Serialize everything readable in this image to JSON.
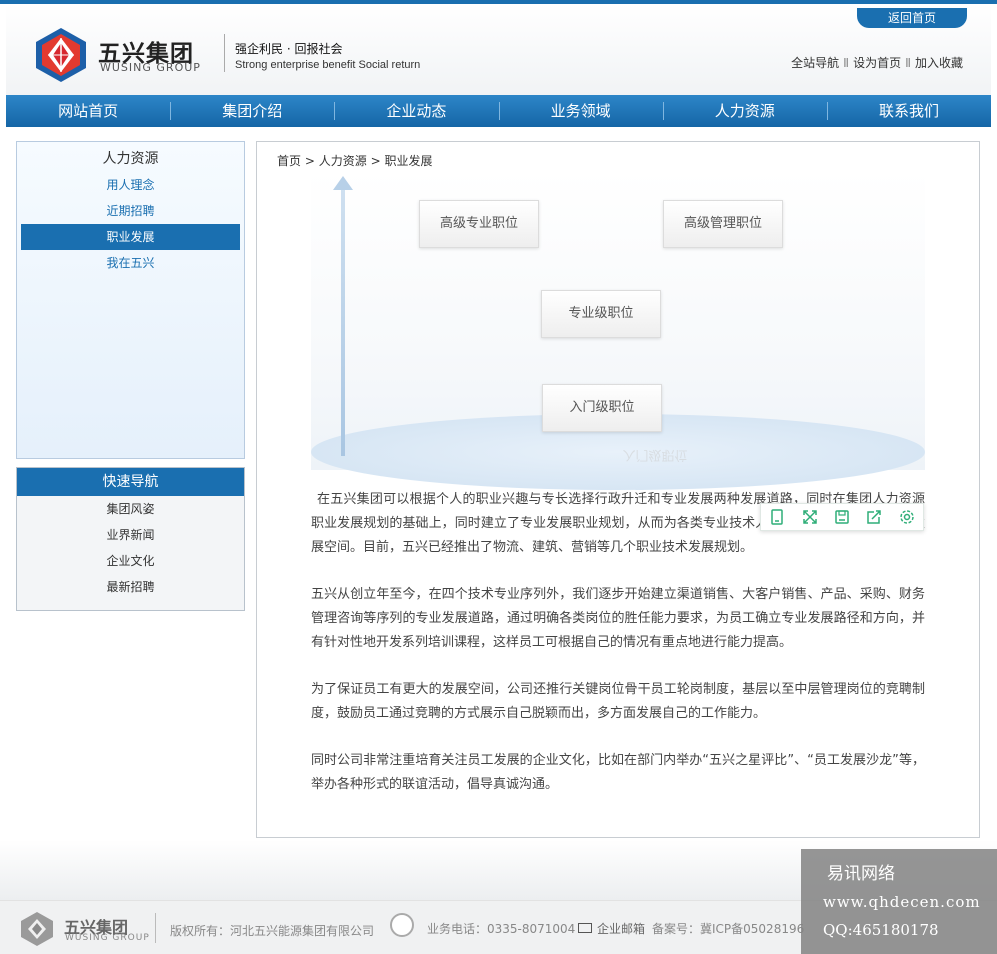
{
  "header": {
    "back_home": "返回首页",
    "logo_cn": "五兴集团",
    "logo_en": "WUSING GROUP",
    "slogan_cn": "强企利民 · 回报社会",
    "slogan_en": "Strong enterprise benefit Social return",
    "links": [
      "全站导航",
      "设为首页",
      "加入收藏"
    ],
    "link_separator": "Ⅱ"
  },
  "nav": {
    "items": [
      "网站首页",
      "集团介绍",
      "企业动态",
      "业务领域",
      "人力资源",
      "联系我们"
    ]
  },
  "sidebar": {
    "title": "人力资源",
    "items": [
      "用人理念",
      "近期招聘",
      "职业发展",
      "我在五兴"
    ],
    "active_index": 2
  },
  "quick_nav": {
    "title": "快速导航",
    "items": [
      "集团风姿",
      "业界新闻",
      "企业文化",
      "最新招聘"
    ]
  },
  "breadcrumb": {
    "home": "首页",
    "sep": ">",
    "section": "人力资源",
    "current": "职业发展"
  },
  "diagram": {
    "senior_pro": "高级专业职位",
    "senior_mgmt": "高级管理职位",
    "pro": "专业级职位",
    "entry": "入门级职位"
  },
  "content": {
    "paragraphs": [
      "在五兴集团可以根据个人的职业兴趣与专长选择行政升迁和专业发展两种发展道路，同时在集团人力资源职业发展规划的基础上，同时建立了专业发展职业规划，从而为各类专业技术人才提供更多的选择机会和发展空间。目前，五兴已经推出了物流、建筑、营销等几个职业技术发展规划。",
      "五兴从创立年至今，在四个技术专业序列外，我们逐步开始建立渠道销售、大客户销售、产品、采购、财务管理咨询等序列的专业发展道路，通过明确各类岗位的胜任能力要求，为员工确立专业发展路径和方向，并有针对性地开发系列培训课程，这样员工可根据自己的情况有重点地进行能力提高。",
      "为了保证员工有更大的发展空间，公司还推行关键岗位骨干员工轮岗制度，基层以至中层管理岗位的竞聘制度，鼓励员工通过竞聘的方式展示自己脱颖而出，多方面发展自己的工作能力。",
      "同时公司非常注重培育关注员工发展的企业文化，比如在部门内举办“五兴之星评比”、“员工发展沙龙”等，举办各种形式的联谊活动，倡导真诚沟通。"
    ]
  },
  "toolbar": {
    "icons": [
      "clip-icon",
      "fullscreen-icon",
      "save-icon",
      "share-icon",
      "settings-icon"
    ]
  },
  "footer": {
    "logo_cn": "五兴集团",
    "logo_en": "WUSING GROUP",
    "copyright": "版权所有：河北五兴能源集团有限公司",
    "phone": "业务电话：0335-8071004",
    "mail": "企业邮箱",
    "icp": "备案号：冀ICP备05028196"
  },
  "watermark": {
    "line1": "易讯网络",
    "line2": "www.qhdecen.com",
    "line3": "QQ:465180178"
  },
  "colors": {
    "brand_blue": "#1a6fb0",
    "logo_red": "#d7282f",
    "logo_blue": "#1d5fa8"
  }
}
